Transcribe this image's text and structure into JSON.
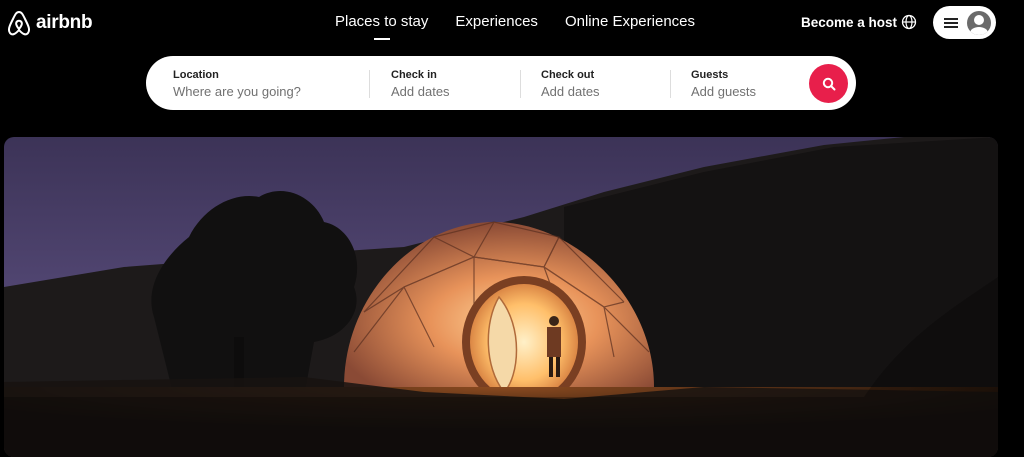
{
  "header": {
    "logo_text": "airbnb",
    "nav": [
      {
        "label": "Places to stay"
      },
      {
        "label": "Experiences"
      },
      {
        "label": "Online Experiences"
      }
    ],
    "become_host": "Become a host"
  },
  "search": {
    "location": {
      "label": "Location",
      "placeholder": "Where are you going?"
    },
    "checkin": {
      "label": "Check in",
      "placeholder": "Add dates"
    },
    "checkout": {
      "label": "Check out",
      "placeholder": "Add dates"
    },
    "guests": {
      "label": "Guests",
      "placeholder": "Add guests"
    }
  },
  "colors": {
    "accent": "#e81f4b",
    "background": "#000000"
  },
  "icons": [
    "airbnb-logo-icon",
    "globe-icon",
    "hamburger-menu-icon",
    "user-avatar-icon",
    "search-icon"
  ]
}
